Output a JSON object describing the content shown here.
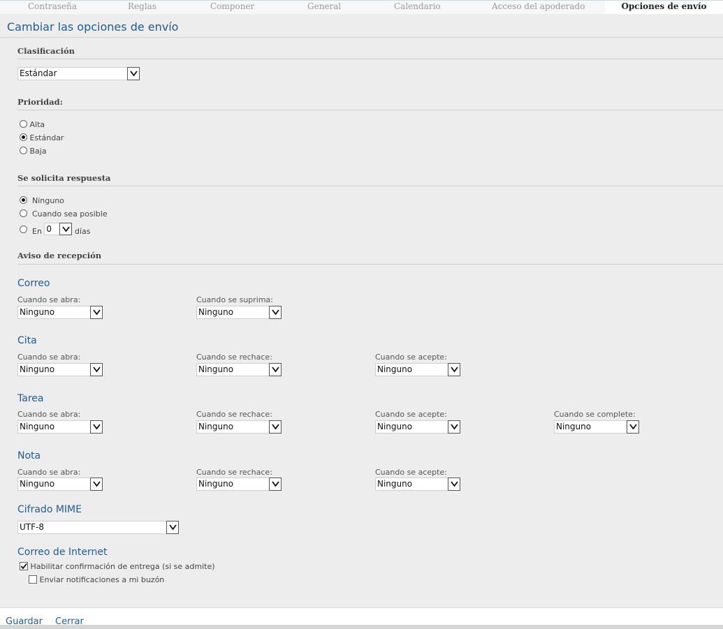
{
  "tabs": [
    "Contraseña",
    "Reglas",
    "Componer",
    "General",
    "Calendario",
    "Acceso del apoderado",
    "Opciones de envío"
  ],
  "page_title": "Cambiar las opciones de envío",
  "classification": {
    "heading": "Clasificación",
    "value": "Estándar"
  },
  "priority": {
    "heading": "Prioridad:",
    "options": [
      "Alta",
      "Estándar",
      "Baja"
    ],
    "selected": "Estándar"
  },
  "reply": {
    "heading": "Se solicita respuesta",
    "none": "Ninguno",
    "when_possible": "Cuando sea posible",
    "in_prefix": "En",
    "days_value": "0",
    "days_suffix": "días",
    "selected": "Ninguno"
  },
  "receipt": {
    "heading": "Aviso de recepción",
    "mail": {
      "title": "Correo",
      "open_label": "Cuando se abra:",
      "open_value": "Ninguno",
      "delete_label": "Cuando se suprima:",
      "delete_value": "Ninguno"
    },
    "appointment": {
      "title": "Cita",
      "open_label": "Cuando se abra:",
      "open_value": "Ninguno",
      "reject_label": "Cuando se rechace:",
      "reject_value": "Ninguno",
      "accept_label": "Cuando se acepte:",
      "accept_value": "Ninguno"
    },
    "task": {
      "title": "Tarea",
      "open_label": "Cuando se abra:",
      "open_value": "Ninguno",
      "reject_label": "Cuando se rechace:",
      "reject_value": "Ninguno",
      "accept_label": "Cuando se acepte:",
      "accept_value": "Ninguno",
      "complete_label": "Cuando se complete:",
      "complete_value": "Ninguno"
    },
    "note": {
      "title": "Nota",
      "open_label": "Cuando se abra:",
      "open_value": "Ninguno",
      "reject_label": "Cuando se rechace:",
      "reject_value": "Ninguno",
      "accept_label": "Cuando se acepte:",
      "accept_value": "Ninguno"
    }
  },
  "mime": {
    "title": "Cifrado MIME",
    "value": "UTF-8"
  },
  "internet": {
    "title": "Correo de Internet",
    "delivery_label": "Habilitar confirmación de entrega (si se admite)",
    "delivery_checked": true,
    "notify_label": "Enviar notificaciones a mi buzón",
    "notify_checked": false
  },
  "footer": {
    "save": "Guardar",
    "close": "Cerrar"
  },
  "colors": {
    "accent": "#1f5c99",
    "panel": "#ededed"
  }
}
